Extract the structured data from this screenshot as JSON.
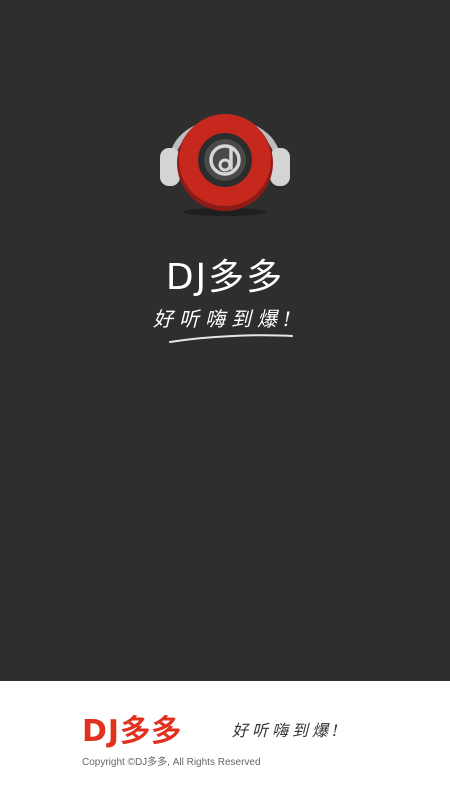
{
  "app": {
    "title": "DJ多多",
    "slogan": "好听嗨到爆!"
  },
  "footer": {
    "brand": "DJ多多",
    "slogan": "好听嗨到爆!",
    "copyright": "Copyright ©DJ多多, All Rights Reserved"
  },
  "colors": {
    "background": "#2e2e2e",
    "brand_red": "#e1301e",
    "footer_background": "#ffffff"
  },
  "icons": {
    "logo": "headphones-vinyl-music-note-icon"
  }
}
